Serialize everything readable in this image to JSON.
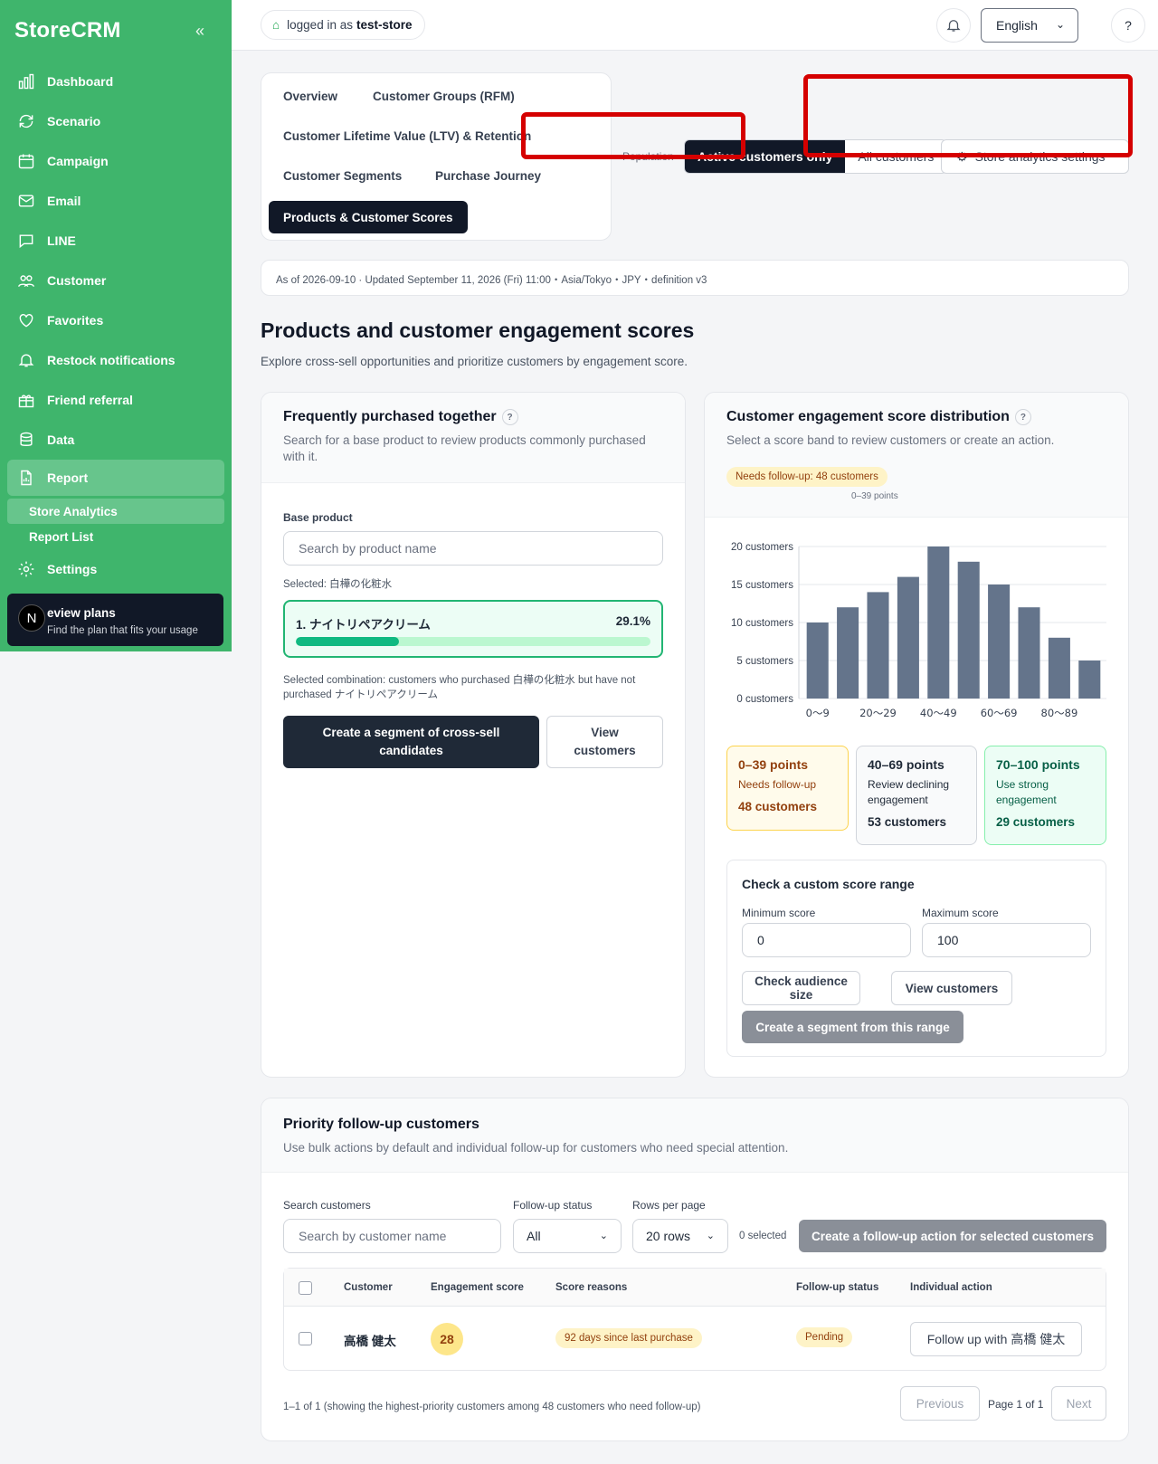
{
  "sidebar": {
    "brand": "StoreCRM",
    "items": [
      {
        "label": "Dashboard",
        "icon": "chart-bars-icon"
      },
      {
        "label": "Scenario",
        "icon": "refresh-icon"
      },
      {
        "label": "Campaign",
        "icon": "calendar-icon"
      },
      {
        "label": "Email",
        "icon": "mail-icon"
      },
      {
        "label": "LINE",
        "icon": "chat-icon"
      },
      {
        "label": "Customer",
        "icon": "users-icon"
      },
      {
        "label": "Favorites",
        "icon": "heart-icon"
      },
      {
        "label": "Restock notifications",
        "icon": "bell-icon"
      },
      {
        "label": "Friend referral",
        "icon": "gift-icon"
      },
      {
        "label": "Data",
        "icon": "database-icon"
      },
      {
        "label": "Report",
        "icon": "document-icon"
      }
    ],
    "report_sub": [
      "Store Analytics",
      "Report List"
    ],
    "settings": "Settings",
    "plan_title": "eview plans",
    "plan_sub": "Find the plan that fits your usage",
    "plan_avatar": "N"
  },
  "topbar": {
    "login_prefix": "logged in as",
    "store": "test-store",
    "language": "English",
    "help": "?"
  },
  "tabs": [
    "Overview",
    "Customer Groups (RFM)",
    "Customer Lifetime Value (LTV) & Retention",
    "Customer Segments",
    "Purchase Journey",
    "Products & Customer Scores"
  ],
  "population": {
    "label": "Population",
    "active": "Active customers only",
    "all": "All customers",
    "settings": "Store analytics settings"
  },
  "asof": "As of 2026-09-10 · Updated September 11, 2026 (Fri) 11:00・Asia/Tokyo・JPY・definition v3",
  "page": {
    "title": "Products and customer engagement scores",
    "subtitle": "Explore cross-sell opportunities and prioritize customers by engagement score."
  },
  "cross_sell": {
    "title": "Frequently purchased together",
    "desc": "Search for a base product to review products commonly purchased with it.",
    "base_label": "Base product",
    "search_placeholder": "Search by product name",
    "selected": "Selected: 白樺の化粧水",
    "result_name": "1. ナイトリペアクリーム",
    "result_pct": "29.1%",
    "result_value": 29.1,
    "combination": "Selected combination: customers who purchased 白樺の化粧水 but have not purchased ナイトリペアクリーム",
    "create_btn": "Create a segment of cross-sell candidates",
    "view_btn": "View customers"
  },
  "scores": {
    "title": "Customer engagement score distribution",
    "desc": "Select a score band to review customers or create an action.",
    "badge": "Needs follow-up: 48 customers",
    "badge_sub": "0–39 points",
    "bands": [
      {
        "range": "0–39 points",
        "label": "Needs follow-up",
        "count": "48 customers",
        "color": "#fffbeb",
        "border": "#fcd34d",
        "text": "#92400e"
      },
      {
        "range": "40–69 points",
        "label": "Review declining engagement",
        "count": "53 customers",
        "color": "#f9fafb",
        "border": "#d1d5db",
        "text": "#1f2937"
      },
      {
        "range": "70–100 points",
        "label": "Use strong engagement",
        "count": "29 customers",
        "color": "#ecfdf5",
        "border": "#86efac",
        "text": "#065f46"
      }
    ],
    "custom": {
      "title": "Check a custom score range",
      "min_label": "Minimum score",
      "max_label": "Maximum score",
      "min_value": "0",
      "max_value": "100",
      "check_btn": "Check audience size",
      "view_btn": "View customers",
      "create_btn": "Create a segment from this range"
    }
  },
  "chart_data": {
    "type": "bar",
    "categories": [
      "0〜9",
      "10〜19",
      "20〜29",
      "30〜39",
      "40〜49",
      "50〜59",
      "60〜69",
      "70〜79",
      "80〜89",
      "90〜100"
    ],
    "x_tick_labels": [
      "0〜9",
      "20〜29",
      "40〜49",
      "60〜69",
      "80〜89"
    ],
    "values": [
      10,
      12,
      14,
      16,
      20,
      18,
      15,
      12,
      8,
      5
    ],
    "ylim": [
      0,
      20
    ],
    "y_ticks": [
      "0 customers",
      "5 customers",
      "10 customers",
      "15 customers",
      "20 customers"
    ],
    "grid": true,
    "color": "#64748b"
  },
  "priority": {
    "title": "Priority follow-up customers",
    "desc": "Use bulk actions by default and individual follow-up for customers who need special attention.",
    "search_label": "Search customers",
    "search_placeholder": "Search by customer name",
    "status_label": "Follow-up status",
    "status_value": "All",
    "rows_label": "Rows per page",
    "rows_value": "20 rows",
    "selected": "0 selected",
    "bulk_btn": "Create a follow-up action for selected customers",
    "columns": [
      "Customer",
      "Engagement score",
      "Score reasons",
      "Follow-up status",
      "Individual action"
    ],
    "rows": [
      {
        "name": "高橋 健太",
        "score": "28",
        "reason": "92 days since last purchase",
        "status": "Pending",
        "action": "Follow up with 高橋 健太"
      }
    ],
    "footer": "1–1 of 1 (showing the highest-priority customers among 48 customers who need follow-up)",
    "prev": "Previous",
    "page": "Page 1 of 1",
    "next": "Next"
  }
}
